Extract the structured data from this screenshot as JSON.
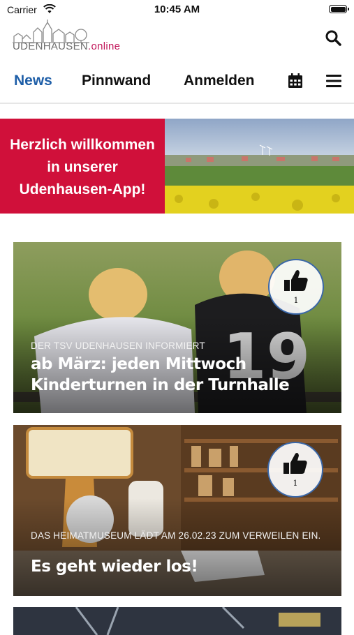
{
  "status_bar": {
    "carrier": "Carrier",
    "time": "10:45 AM"
  },
  "header": {
    "logo_main": "UDENHAUSEN",
    "logo_suffix": ".online",
    "search_icon": "search-icon"
  },
  "nav": {
    "items": [
      {
        "label": "News",
        "active": true
      },
      {
        "label": "Pinnwand",
        "active": false
      },
      {
        "label": "Anmelden",
        "active": false
      }
    ],
    "calendar_icon": "calendar-icon",
    "menu_icon": "hamburger-menu-icon"
  },
  "banner": {
    "line1": "Herzlich willkommen",
    "line2": "in unserer",
    "line3": "Udenhausen-App!"
  },
  "cards": [
    {
      "kicker": "DER TSV UDENHAUSEN INFORMIERT",
      "title": "ab März: jeden Mittwoch Kinderturnen in der Turnhalle",
      "likes": "1"
    },
    {
      "kicker": "DAS HEIMATMUSEUM LÄDT AM 26.02.23 ZUM VERWEILEN EIN.",
      "title": "Es geht wieder los!",
      "likes": "1"
    }
  ],
  "colors": {
    "accent": "#1f5fa8",
    "brand_red": "#d0103a",
    "logo_pink": "#c2185b"
  }
}
